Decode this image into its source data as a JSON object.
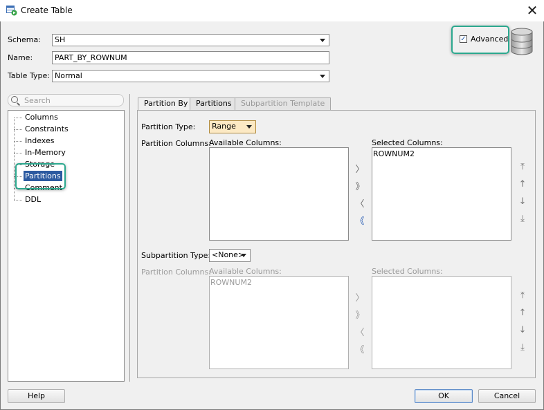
{
  "window": {
    "title": "Create Table",
    "close_glyph": "✕"
  },
  "form": {
    "schema_label": "Schema:",
    "schema_value": "SH",
    "name_label": "Name:",
    "name_value": "PART_BY_ROWNUM",
    "table_type_label": "Table Type:",
    "table_type_value": "Normal",
    "advanced_label": "Advanced",
    "advanced_checked": true
  },
  "search": {
    "placeholder": "Search"
  },
  "nav": {
    "items": [
      {
        "label": "Columns"
      },
      {
        "label": "Constraints"
      },
      {
        "label": "Indexes"
      },
      {
        "label": "In-Memory"
      },
      {
        "label": "Storage"
      },
      {
        "label": "Partitions",
        "selected": true
      },
      {
        "label": "Comment"
      },
      {
        "label": "DDL"
      }
    ]
  },
  "tabs": [
    {
      "label": "Partition By",
      "state": "active"
    },
    {
      "label": "Partitions",
      "state": "normal"
    },
    {
      "label": "Subpartition Template",
      "state": "disabled"
    }
  ],
  "partition": {
    "type_label": "Partition Type:",
    "type_value": "Range",
    "columns_label": "Partition Columns:",
    "available_label": "Available Columns:",
    "selected_label": "Selected Columns:",
    "available_items": [],
    "selected_items": [
      "ROWNUM2"
    ]
  },
  "subpartition": {
    "type_label": "Subpartition Type:",
    "type_value": "<None>",
    "columns_label": "Partition Columns:",
    "available_label": "Available Columns:",
    "selected_label": "Selected Columns:",
    "available_items": [
      "ROWNUM2"
    ],
    "selected_items": []
  },
  "movers": {
    "add": "〉",
    "add_all": "》",
    "remove": "〈",
    "remove_all": "《"
  },
  "order_buttons": {
    "top": "⤒",
    "up": "↑",
    "down": "↓",
    "bottom": "⤓"
  },
  "buttons": {
    "help": "Help",
    "ok": "OK",
    "cancel": "Cancel"
  },
  "colors": {
    "accent": "#2ba88e",
    "selection": "#2c5aa0"
  }
}
